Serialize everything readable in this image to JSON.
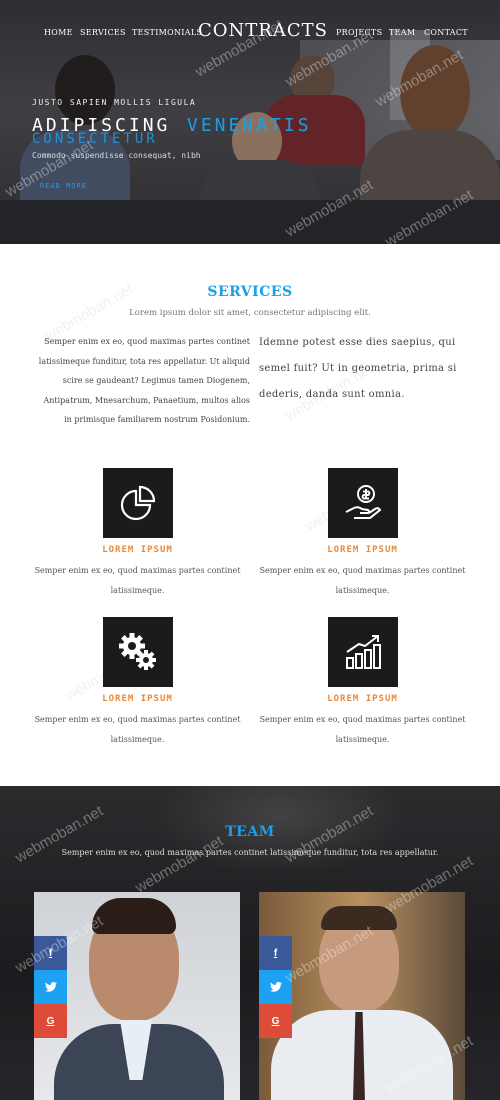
{
  "nav": {
    "brand": "CONTRACTS",
    "items_left": [
      "HOME",
      "SERVICES",
      "TESTIMONIALS"
    ],
    "items_right": [
      "PROJECTS",
      "TEAM",
      "CONTACT"
    ]
  },
  "hero": {
    "kicker": "JUSTO SAPIEN MOLLIS LIGULA",
    "title_white": "ADIPISCING",
    "title_blue": "VENENATIS",
    "title_blue_2": "CONSECTETUR",
    "subtitle": "Commodo suspendisse consequat, nibh",
    "cta": "READ MORE"
  },
  "services": {
    "title": "SERVICES",
    "lead": "Lorem ipsum dolor sit amet, consectetur adipiscing elit.",
    "left_text": "Semper enim ex eo, quod maximas partes continet latissimeque funditur, tota res appellatur. Ut aliquid scire se gaudeant? Legimus tamen Diogenem, Antipatrum, Mnesarchum, Panaetium, multos alios in primisque familiarem nostrum Posidonium.",
    "right_text": "Idemne potest esse dies saepius, qui semel fuit? Ut in geometria, prima si dederis, danda sunt omnia.",
    "features": [
      {
        "icon": "pie-chart-icon",
        "name": "LOREM IPSUM",
        "desc": "Semper enim ex eo, quod maximas partes continet latissimeque."
      },
      {
        "icon": "money-hand-icon",
        "name": "LOREM IPSUM",
        "desc": "Semper enim ex eo, quod maximas partes continet latissimeque."
      },
      {
        "icon": "gears-icon",
        "name": "LOREM IPSUM",
        "desc": "Semper enim ex eo, quod maximas partes continet latissimeque."
      },
      {
        "icon": "growth-chart-icon",
        "name": "LOREM IPSUM",
        "desc": "Semper enim ex eo, quod maximas partes continet latissimeque."
      }
    ]
  },
  "team": {
    "title": "TEAM",
    "lead": "Semper enim ex eo, quod maximas partes continet latissimeque funditur, tota res appellatur.",
    "social": {
      "facebook": "f",
      "twitter": "t",
      "google": "G"
    }
  },
  "watermark": "webmoban.net",
  "colors": {
    "accent": "#1aa0e8",
    "feature_title": "#e8893a",
    "icon_box": "#1b1b1b",
    "facebook": "#3b5998",
    "twitter": "#1da1f2",
    "google": "#dd4b39"
  }
}
